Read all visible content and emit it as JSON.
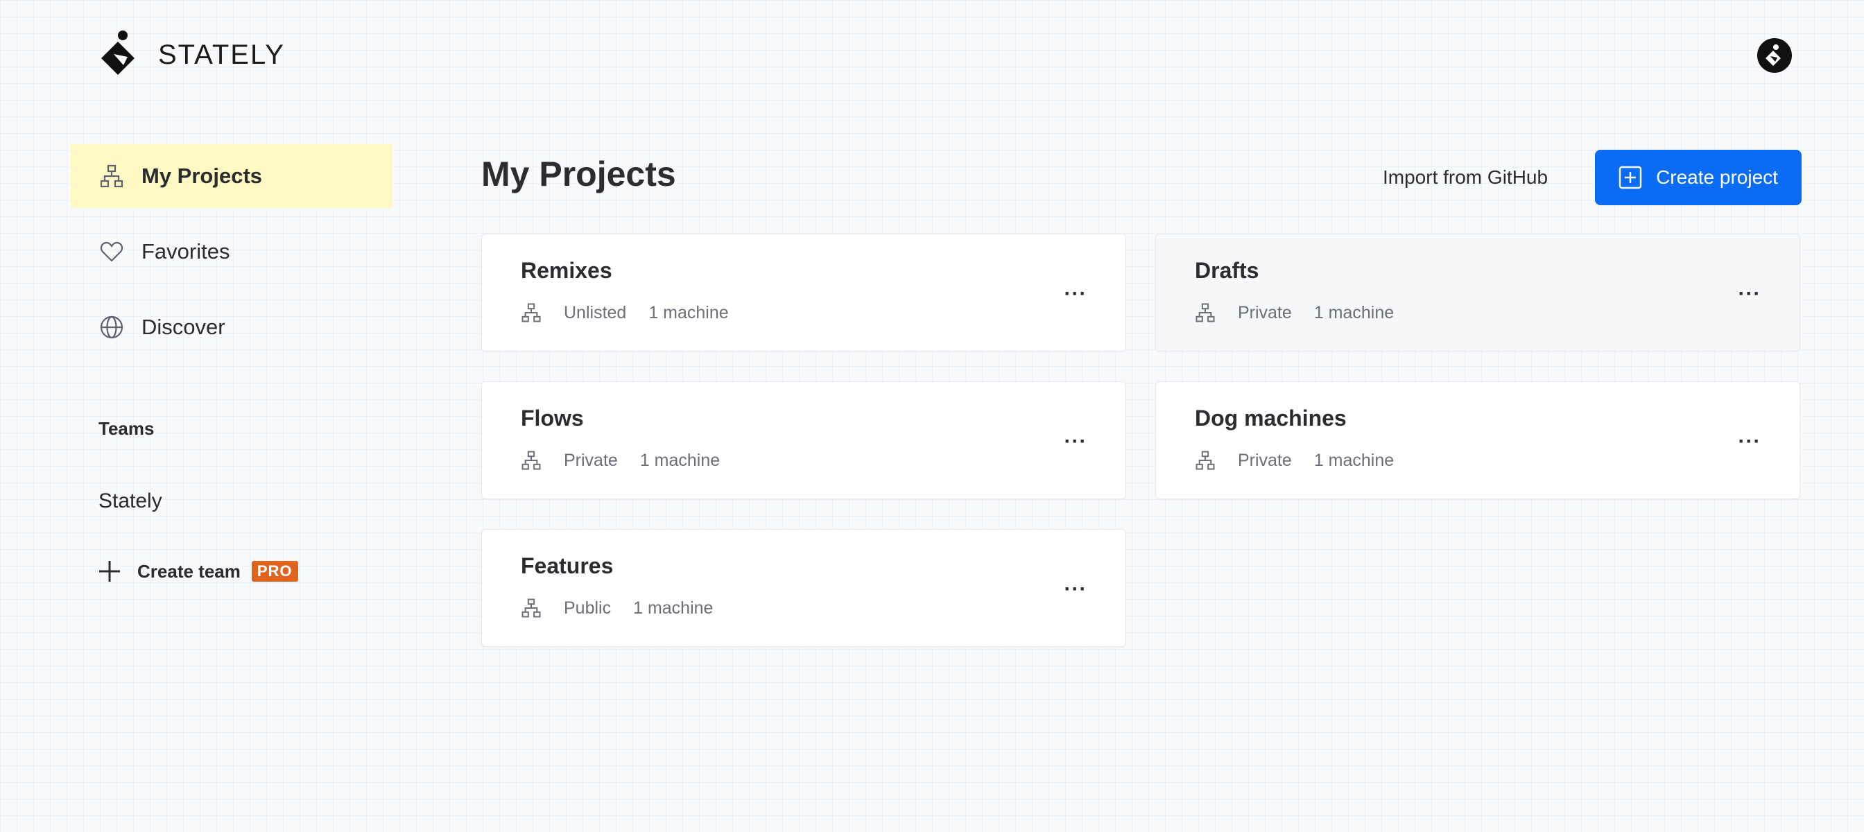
{
  "brand": {
    "name": "STATELY"
  },
  "sidebar": {
    "items": [
      {
        "label": "My Projects",
        "icon": "hierarchy-icon",
        "active": true
      },
      {
        "label": "Favorites",
        "icon": "heart-icon"
      },
      {
        "label": "Discover",
        "icon": "globe-icon"
      }
    ],
    "teams_heading": "Teams",
    "teams": [
      {
        "name": "Stately"
      }
    ],
    "create_team_label": "Create team",
    "pro_badge": "PRO"
  },
  "main": {
    "title": "My Projects",
    "import_label": "Import from GitHub",
    "create_label": "Create project",
    "accent_color": "#0a6cf5",
    "more_label": "···",
    "projects": [
      {
        "title": "Remixes",
        "visibility": "Unlisted",
        "count": "1 machine"
      },
      {
        "title": "Drafts",
        "visibility": "Private",
        "count": "1 machine"
      },
      {
        "title": "Flows",
        "visibility": "Private",
        "count": "1 machine"
      },
      {
        "title": "Dog machines",
        "visibility": "Private",
        "count": "1 machine"
      },
      {
        "title": "Features",
        "visibility": "Public",
        "count": "1 machine"
      }
    ]
  }
}
